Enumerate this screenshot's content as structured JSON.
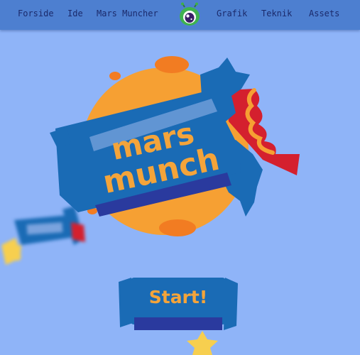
{
  "nav": {
    "left_links": [
      "Forside",
      "Ide",
      "Mars Muncher"
    ],
    "right_links": [
      "Grafik",
      "Teknik",
      "Assets"
    ],
    "logo_icon": "alien-logo-icon"
  },
  "hero": {
    "logo_line1": "mars",
    "logo_line2": "munch"
  },
  "start_button": {
    "label": "Start!"
  },
  "colors": {
    "background": "#8fb4f8",
    "nav_bar": "#4d7fd0",
    "nav_text": "#1b2a6b",
    "planet_orange": "#f6a033",
    "wrapper_blue": "#1a6bb5",
    "logo_text_orange": "#f4a43a",
    "bitten_red": "#d4202e",
    "star_yellow": "#f7cf4f"
  }
}
